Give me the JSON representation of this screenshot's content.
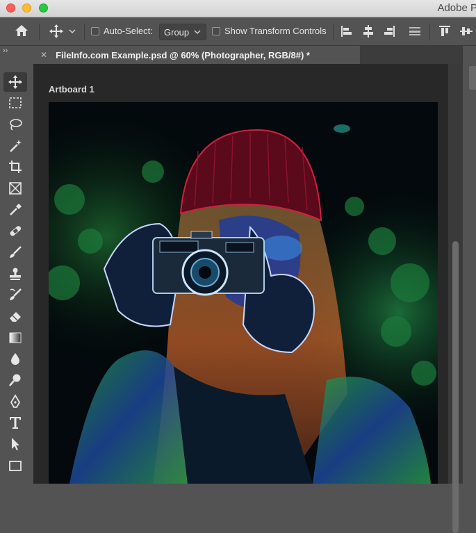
{
  "window": {
    "app_title": "Adobe P"
  },
  "options_bar": {
    "auto_select_label": "Auto-Select:",
    "auto_select_value": "Group",
    "show_transform_label": "Show Transform Controls",
    "collapse_glyph": "››"
  },
  "document_tab": {
    "title": "FileInfo.com Example.psd @ 60% (Photographer, RGB/8#) *",
    "close_glyph": "✕"
  },
  "canvas": {
    "artboard_label": "Artboard 1"
  },
  "tools": [
    "move-tool",
    "marquee-tool",
    "lasso-tool",
    "magic-wand-tool",
    "crop-tool",
    "frame-tool",
    "eyedropper-tool",
    "healing-brush-tool",
    "brush-tool",
    "clone-stamp-tool",
    "history-brush-tool",
    "eraser-tool",
    "gradient-tool",
    "blur-tool",
    "dodge-tool",
    "pen-tool",
    "type-tool",
    "path-selection-tool",
    "rectangle-tool"
  ],
  "colors": {
    "ui_bg": "#535353",
    "canvas_bg": "#282828",
    "tab_bg": "#3c3c3c"
  }
}
